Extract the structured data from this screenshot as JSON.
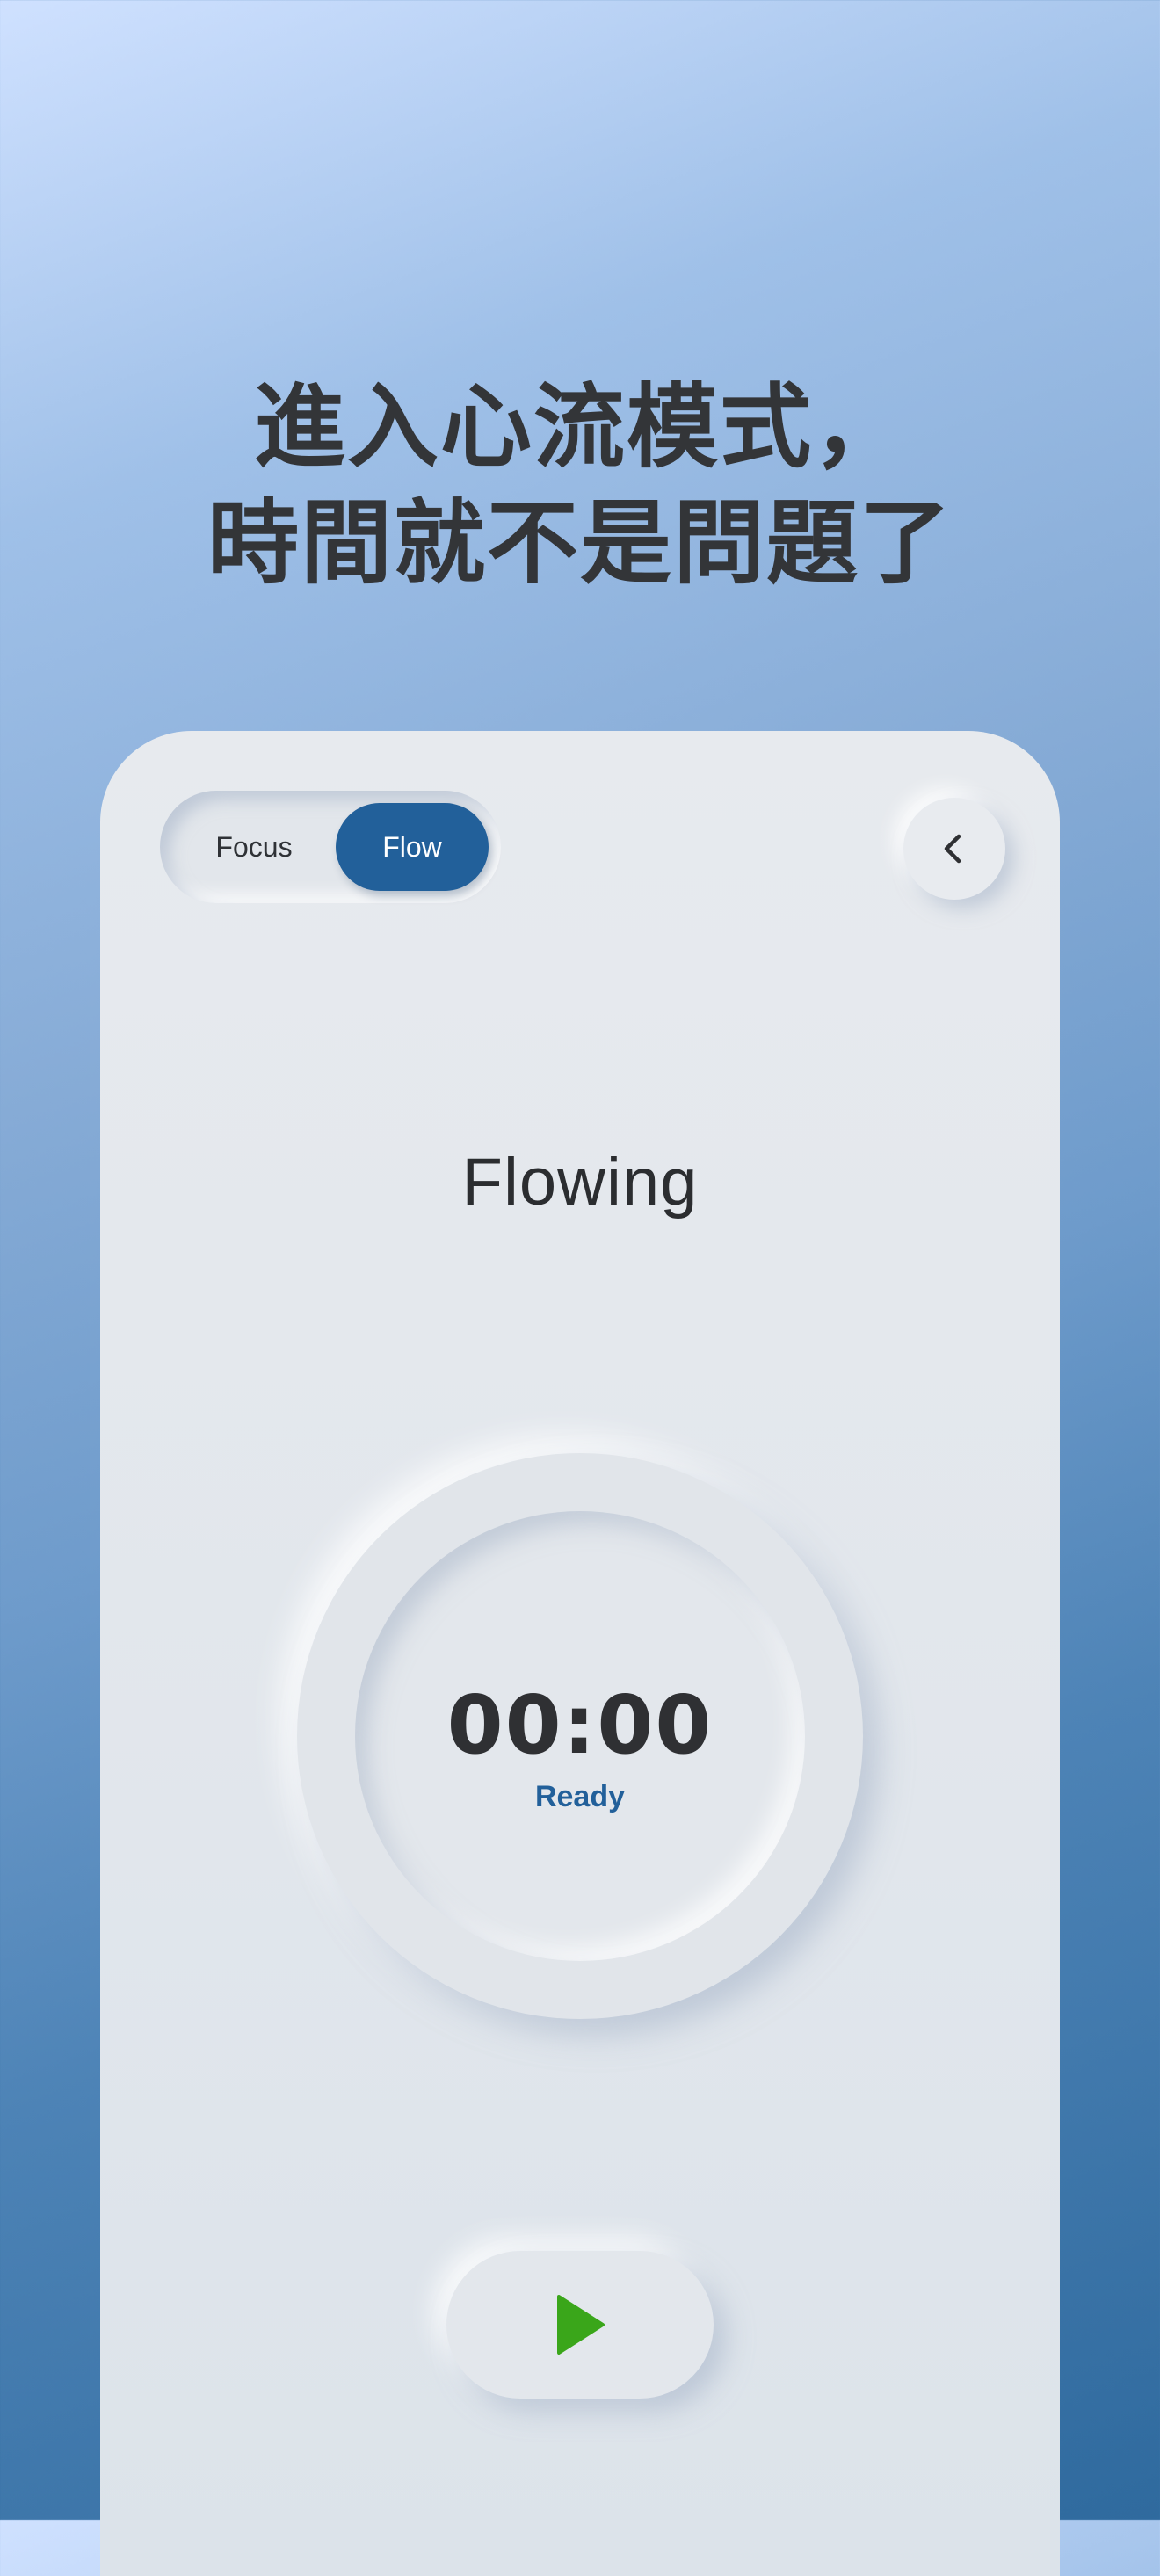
{
  "headline": {
    "line1": "進入心流模式，",
    "line2": "時間就不是問題了"
  },
  "app": {
    "mode_toggle": {
      "options": [
        {
          "label": "Focus",
          "selected": false
        },
        {
          "label": "Flow",
          "selected": true
        }
      ]
    },
    "back_button_icon": "chevron-left-icon",
    "mode_title": "Flowing",
    "timer": {
      "value": "00:00",
      "status": "Ready"
    },
    "play_button_icon": "play-icon"
  },
  "colors": {
    "accent": "#22609a",
    "play": "#3aa61a",
    "text": "#2f3033"
  }
}
